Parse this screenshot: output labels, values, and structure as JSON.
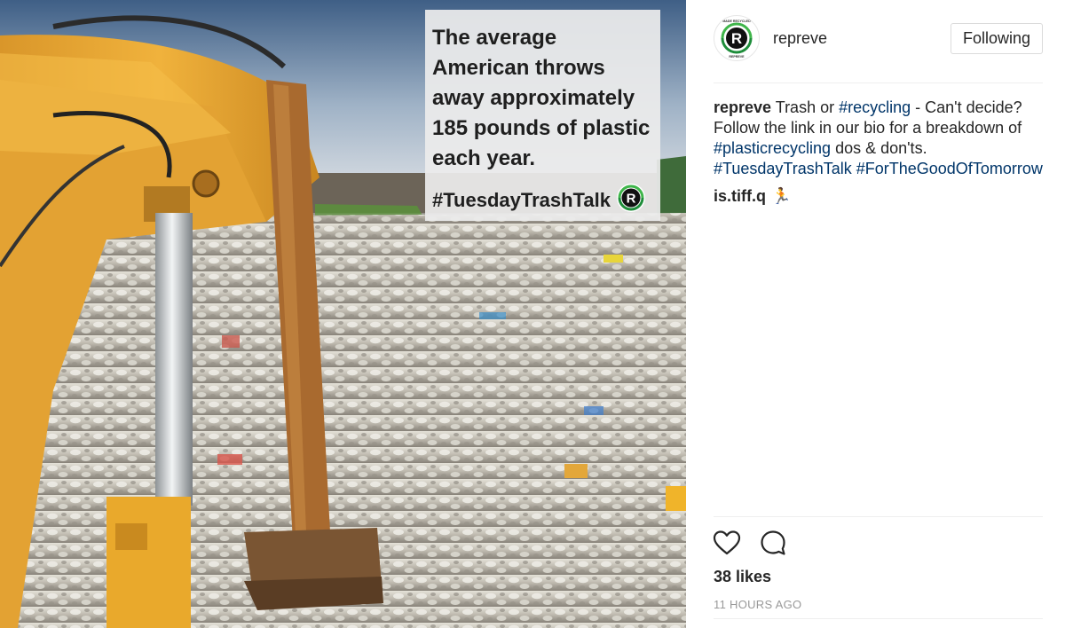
{
  "photo": {
    "overlay_text": "The average American throws away approximately 185 pounds of plastic each year.",
    "overlay_hashtag": "#TuesdayTrashTalk",
    "logo_letter": "R"
  },
  "header": {
    "username": "repreve",
    "follow_label": "Following",
    "avatar_letter": "R",
    "avatar_top_text": "MADE RECYCLED",
    "avatar_bottom_text": "REPREVE"
  },
  "caption": {
    "user": "repreve",
    "t1": " Trash or ",
    "tag1": "#recycling",
    "t2": " - Can't decide? Follow the link in our bio for a breakdown of ",
    "tag2": "#plasticrecycling",
    "t3": " dos & don'ts. ",
    "tag3": "#TuesdayTrashTalk",
    "t4": " ",
    "tag4": "#ForTheGoodOfTomorrow"
  },
  "comment": {
    "user": "is.tiff.q",
    "emoji": "🏃"
  },
  "actions": {
    "like_icon": "heart-icon",
    "comment_icon": "comment-icon"
  },
  "likes": "38 likes",
  "timestamp": "11 HOURS AGO"
}
